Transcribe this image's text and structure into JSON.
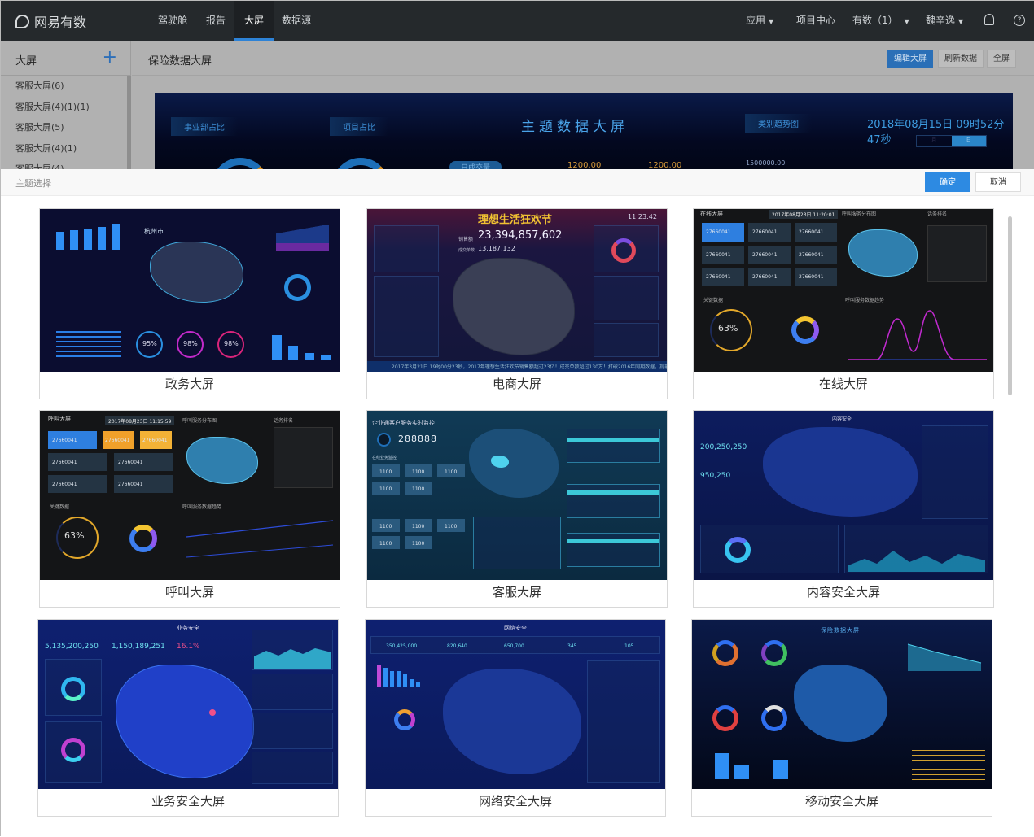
{
  "nav": {
    "brand": "网易有数",
    "items": [
      "驾驶舱",
      "报告",
      "大屏",
      "数据源"
    ],
    "active": "大屏",
    "right": {
      "apps": "应用",
      "project_center": "项目中心",
      "youshu": "有数（1）",
      "user": "魏辛逸"
    },
    "icons": [
      "bell-icon",
      "help-icon"
    ]
  },
  "sidebar": {
    "title": "大屏",
    "add": "+",
    "items": [
      "客服大屏(6)",
      "客服大屏(4)(1)(1)",
      "客服大屏(5)",
      "客服大屏(4)(1)",
      "客服大屏(4)"
    ]
  },
  "main": {
    "title": "保险数据大屏",
    "buttons": {
      "edit": "编辑大屏",
      "refresh": "刷新数据",
      "fullscreen": "全屏"
    },
    "preview": {
      "label1": "事业部占比",
      "label2": "项目占比",
      "title": "主题数据大屏",
      "label3": "类别趋势图",
      "time": "2018年08月15日 09时52分47秒",
      "toggle_month": "月",
      "toggle_day": "日",
      "btn": "日成交量",
      "val1": "1200.00",
      "val2": "1200.00",
      "axis": "1500000.00"
    }
  },
  "modal": {
    "title": "主题选择",
    "confirm": "确定",
    "cancel": "取消"
  },
  "themes": [
    {
      "name": "政务大屏",
      "city": "杭州市",
      "p1": "95%",
      "p2": "98%",
      "p3": "98%"
    },
    {
      "name": "电商大屏",
      "banner": "理想生活狂欢节",
      "clock": "11:23:42",
      "sales_label": "销售额",
      "sales": "23,394,857,602",
      "orders_label": "成交单数",
      "orders": "13,187,132",
      "ticker": "2017年3月21日 19时00分23秒，2017年理想生活狂欢节销售额超过23亿！成交单数超过130万！打破2016年同期数据，提前"
    },
    {
      "name": "在线大屏",
      "title": "在线大屏",
      "time": "2017年08月23日 11:20:01",
      "map_title": "呼叫服务分布图",
      "rank_title": "话务排名",
      "tile_value": "27660041",
      "key_title": "关键数据",
      "pct": "63%",
      "trend_title": "呼叫服务数据趋势"
    },
    {
      "name": "呼叫大屏",
      "title": "呼叫大屏",
      "time": "2017年08月23日 11:15:59",
      "map_title": "呼叫服务分布图",
      "rank_title": "话务排名",
      "tile_value": "27660041",
      "key_title": "关键数据",
      "pct": "63%",
      "trend_title": "呼叫服务数据趋势"
    },
    {
      "name": "客服大屏",
      "title": "企业通客户服务实时监控",
      "total": "288888",
      "section": "在线业务监控",
      "tile_value": "1100"
    },
    {
      "name": "内容安全大屏",
      "title": "内容安全",
      "v1": "200,250,250",
      "v2": "950,250"
    },
    {
      "name": "业务安全大屏",
      "title": "业务安全",
      "v1": "5,135,200,250",
      "v2": "1,150,189,251",
      "v3": "16.1%"
    },
    {
      "name": "网络安全大屏",
      "title": "网络安全",
      "v1": "350,425,000",
      "v2": "820,640",
      "v3": "650,700",
      "v4": "345",
      "v5": "105"
    },
    {
      "name": "移动安全大屏",
      "title": "保险数据大屏"
    }
  ],
  "colors": {
    "accent": "#2d8ae2",
    "nav_bg": "#25292c"
  }
}
